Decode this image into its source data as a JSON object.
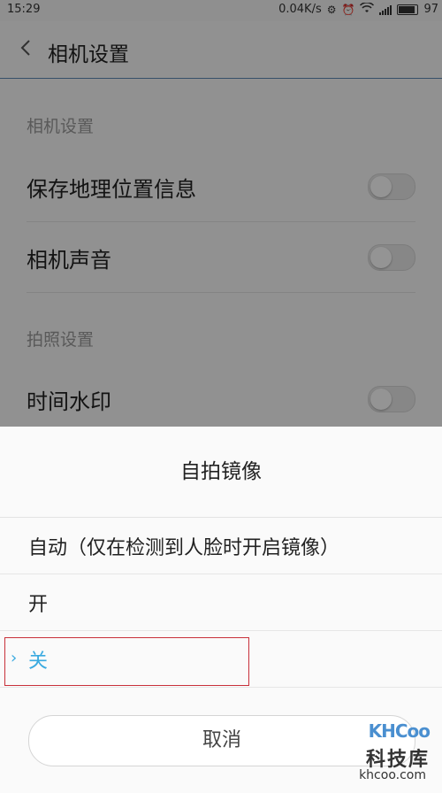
{
  "status_bar": {
    "time": "15:29",
    "network_speed": "0.04K/s",
    "battery": "97"
  },
  "header": {
    "back_icon": "chevron-left-icon",
    "title": "相机设置"
  },
  "settings": {
    "section1_label": "相机设置",
    "rows": [
      {
        "label": "保存地理位置信息",
        "toggle": "off"
      },
      {
        "label": "相机声音",
        "toggle": "off"
      }
    ],
    "section2_label": "拍照设置",
    "rows2": [
      {
        "label": "时间水印",
        "toggle": "off"
      }
    ]
  },
  "sheet": {
    "title": "自拍镜像",
    "options": [
      {
        "label": "自动（仅在检测到人脸时开启镜像）",
        "selected": false
      },
      {
        "label": "开",
        "selected": false
      },
      {
        "label": "关",
        "selected": true
      }
    ],
    "cancel_label": "取消"
  },
  "watermark": {
    "logo_text": "KHCoo",
    "name": "科技库",
    "url": "khcoo.com"
  },
  "colors": {
    "accent": "#3aaae0",
    "highlight_box": "#c8303a",
    "header_divider": "#5e88b5"
  }
}
